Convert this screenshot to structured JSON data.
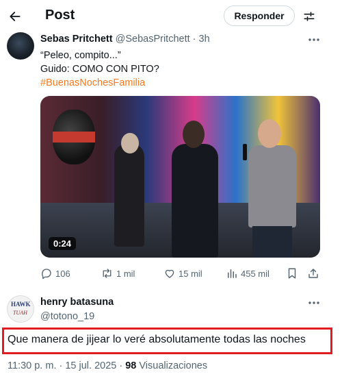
{
  "header": {
    "title": "Post",
    "reply_button": "Responder",
    "icons": {
      "back": "arrow-left-icon",
      "filter": "sliders-icon"
    }
  },
  "post": {
    "author_name": "Sebas Pritchett",
    "author_handle": "@SebasPritchett",
    "separator": "·",
    "time": "3h",
    "lines": [
      "“Peleo, compito...”",
      "Guido: COMO CON PITO?"
    ],
    "hashtag": "#BuenasNochesFamilia",
    "video": {
      "duration": "0:24"
    },
    "stats": {
      "replies": "106",
      "reposts": "1 mil",
      "likes": "15 mil",
      "views": "455 mil"
    },
    "accent_color": "#f4791f"
  },
  "reply": {
    "author_name": "henry batasuna",
    "author_handle": "@totono_19",
    "text": "Que manera de jijear lo veré absolutamente todas las noches",
    "timestamp": "11:30 p. m. · 15 jul. 2025 · ",
    "views_count": "98",
    "views_label": " Visualizaciones",
    "highlight_color": "#e31b23"
  }
}
